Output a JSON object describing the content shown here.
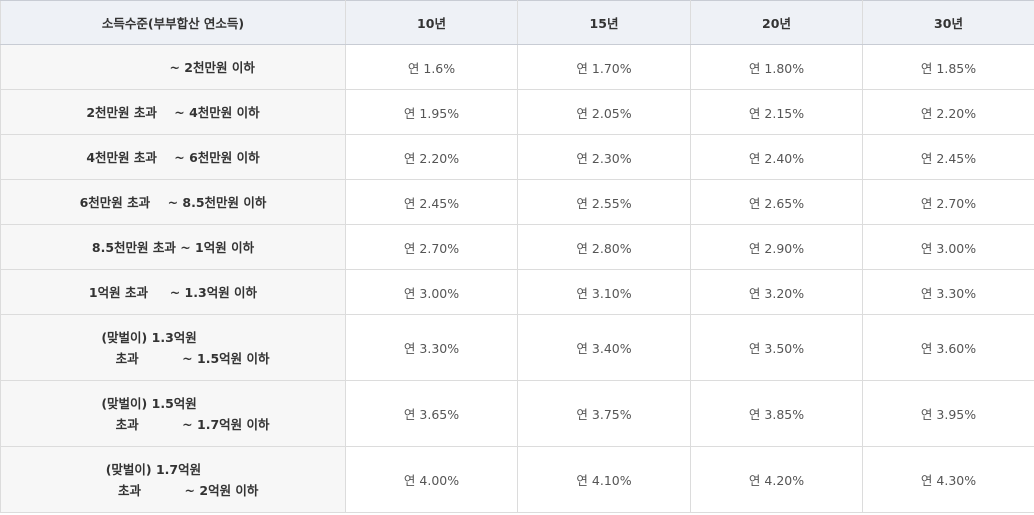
{
  "header": {
    "income_col": "소득수준(부부합산 연소득)",
    "terms": [
      "10년",
      "15년",
      "20년",
      "30년"
    ]
  },
  "rate_prefix": "연",
  "rows": [
    {
      "income": [
        "                  ~ 2천만원 이하"
      ],
      "rates": [
        "1.6%",
        "1.70%",
        "1.80%",
        "1.85%"
      ]
    },
    {
      "income": [
        "2천만원 초과    ~ 4천만원 이하"
      ],
      "rates": [
        "1.95%",
        "2.05%",
        "2.15%",
        "2.20%"
      ]
    },
    {
      "income": [
        "4천만원 초과    ~ 6천만원 이하"
      ],
      "rates": [
        "2.20%",
        "2.30%",
        "2.40%",
        "2.45%"
      ]
    },
    {
      "income": [
        "6천만원 초과    ~ 8.5천만원 이하"
      ],
      "rates": [
        "2.45%",
        "2.55%",
        "2.65%",
        "2.70%"
      ]
    },
    {
      "income": [
        "8.5천만원 초과 ~ 1억원 이하"
      ],
      "rates": [
        "2.70%",
        "2.80%",
        "2.90%",
        "3.00%"
      ]
    },
    {
      "income": [
        "1억원 초과     ~ 1.3억원 이하"
      ],
      "rates": [
        "3.00%",
        "3.10%",
        "3.20%",
        "3.30%"
      ]
    },
    {
      "income": [
        "(맞벌이) 1.3억원           ",
        "         초과          ~ 1.5억원 이하"
      ],
      "rates": [
        "3.30%",
        "3.40%",
        "3.50%",
        "3.60%"
      ]
    },
    {
      "income": [
        "(맞벌이) 1.5억원           ",
        "         초과          ~ 1.7억원 이하"
      ],
      "rates": [
        "3.65%",
        "3.75%",
        "3.85%",
        "3.95%"
      ]
    },
    {
      "income": [
        "(맞벌이) 1.7억원         ",
        "       초과          ~ 2억원 이하"
      ],
      "rates": [
        "4.00%",
        "4.10%",
        "4.20%",
        "4.30%"
      ]
    }
  ]
}
